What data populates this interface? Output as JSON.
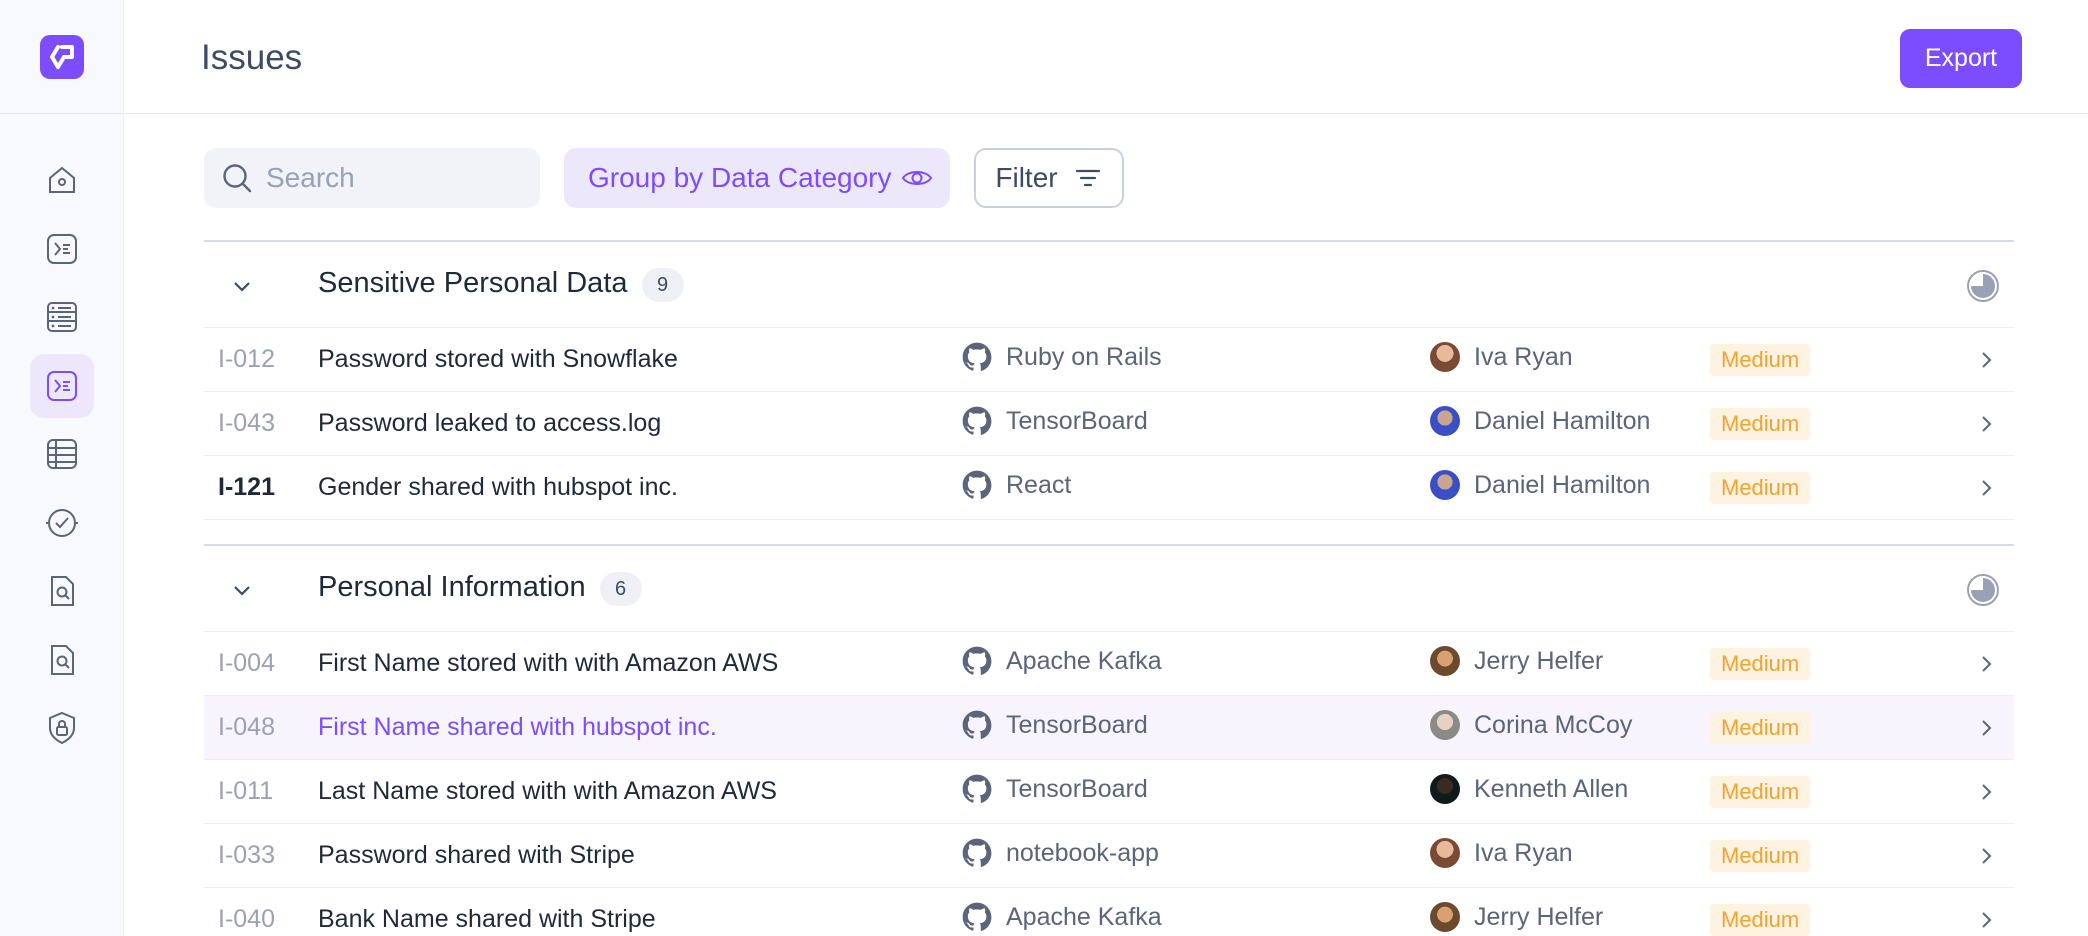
{
  "header": {
    "title": "Issues",
    "export_label": "Export"
  },
  "toolbar": {
    "search_placeholder": "Search",
    "group_label": "Group by Data Category",
    "filter_label": "Filter"
  },
  "sidebar": {
    "items": [
      {
        "icon": "home-icon",
        "active": false
      },
      {
        "icon": "terminal-icon",
        "active": false
      },
      {
        "icon": "server-icon",
        "active": false
      },
      {
        "icon": "issues-icon",
        "active": true
      },
      {
        "icon": "table-icon",
        "active": false
      },
      {
        "icon": "check-circle-icon",
        "active": false
      },
      {
        "icon": "file-search-icon",
        "active": false
      },
      {
        "icon": "file-search-icon",
        "active": false
      },
      {
        "icon": "shield-lock-icon",
        "active": false
      }
    ]
  },
  "groups": [
    {
      "title": "Sensitive Personal Data",
      "count": "9",
      "rows": [
        {
          "id": "I-012",
          "title": "Password stored with Snowflake",
          "repo": "Ruby on Rails",
          "owner": "Iva Ryan",
          "severity": "Medium"
        },
        {
          "id": "I-043",
          "title": "Password leaked to access.log",
          "repo": "TensorBoard",
          "owner": "Daniel Hamilton",
          "severity": "Medium"
        },
        {
          "id": "I-121",
          "title": "Gender shared with hubspot inc.",
          "repo": "React",
          "owner": "Daniel Hamilton",
          "severity": "Medium"
        }
      ]
    },
    {
      "title": "Personal Information",
      "count": "6",
      "rows": [
        {
          "id": "I-004",
          "title": "First Name stored with with Amazon AWS",
          "repo": "Apache Kafka",
          "owner": "Jerry Helfer",
          "severity": "Medium"
        },
        {
          "id": "I-048",
          "title": "First Name shared with hubspot inc.",
          "repo": "TensorBoard",
          "owner": "Corina McCoy",
          "severity": "Medium"
        },
        {
          "id": "I-011",
          "title": "Last Name stored with with Amazon AWS",
          "repo": "TensorBoard",
          "owner": "Kenneth Allen",
          "severity": "Medium"
        },
        {
          "id": "I-033",
          "title": "Password shared with Stripe",
          "repo": "notebook-app",
          "owner": "Iva Ryan",
          "severity": "Medium"
        },
        {
          "id": "I-040",
          "title": "Bank Name shared with Stripe",
          "repo": "Apache Kafka",
          "owner": "Jerry Helfer",
          "severity": "Medium"
        }
      ]
    }
  ],
  "colors": {
    "accent": "#7c4dff",
    "severity_text": "#f0a232",
    "severity_bg": "#fdf3e0"
  }
}
